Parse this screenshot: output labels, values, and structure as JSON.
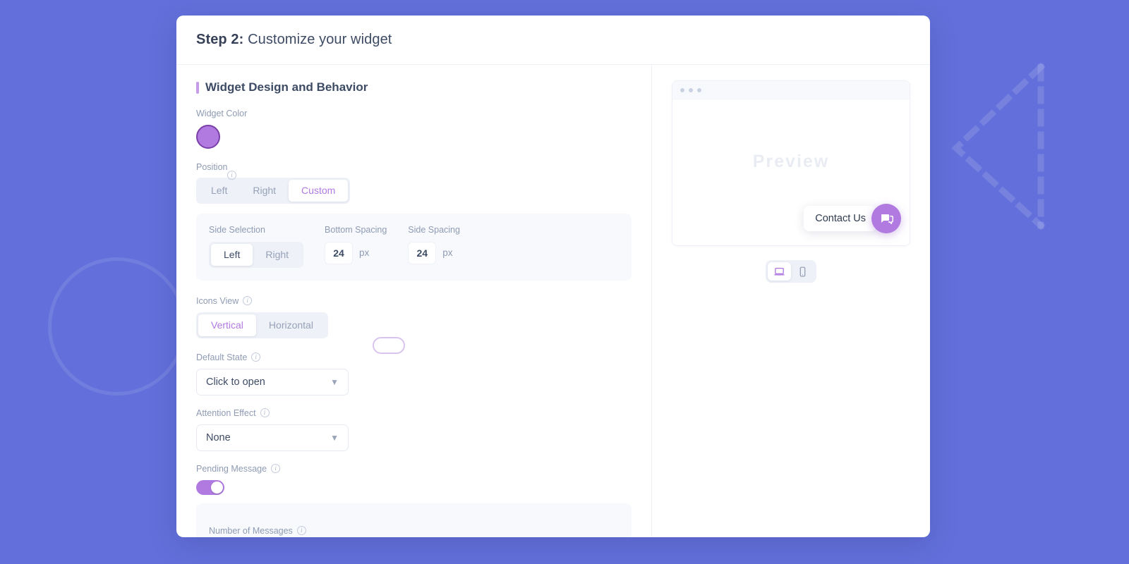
{
  "theme": {
    "background": "#6370db",
    "accent_purple": "#b07ae0",
    "text_dark": "#3d4b64",
    "text_muted": "#8f9bb3"
  },
  "header": {
    "step_prefix": "Step 2:",
    "title": "Customize your widget"
  },
  "section": {
    "label": "Widget Design and Behavior"
  },
  "fields": {
    "widget_color": {
      "label": "Widget Color",
      "value": "#b07ae0",
      "border": "#7a3fa8"
    },
    "position": {
      "label": "Position",
      "options": [
        "Left",
        "Right",
        "Custom"
      ],
      "selected": "Custom",
      "info_icon": "info-icon"
    },
    "custom_position": {
      "side_selection": {
        "label": "Side Selection",
        "options": [
          "Left",
          "Right"
        ],
        "selected": "Left"
      },
      "bottom_spacing": {
        "label": "Bottom Spacing",
        "value": "24",
        "unit": "px"
      },
      "side_spacing": {
        "label": "Side Spacing",
        "value": "24",
        "unit": "px"
      }
    },
    "icons_view": {
      "label": "Icons View",
      "options": [
        "Vertical",
        "Horizontal"
      ],
      "selected": "Vertical"
    },
    "default_state": {
      "label": "Default State",
      "value": "Click to open"
    },
    "attention_effect": {
      "label": "Attention Effect",
      "value": "None"
    },
    "pending_message": {
      "label": "Pending Message",
      "enabled": true
    },
    "pending_panel": {
      "number_of_messages_label": "Number of Messages"
    }
  },
  "preview": {
    "watermark": "Preview",
    "contact_label": "Contact Us",
    "launcher_icon": "chat-bubble-icon",
    "devices": [
      {
        "name": "desktop",
        "icon": "laptop-icon",
        "active": true
      },
      {
        "name": "mobile",
        "icon": "phone-icon",
        "active": false
      }
    ]
  }
}
